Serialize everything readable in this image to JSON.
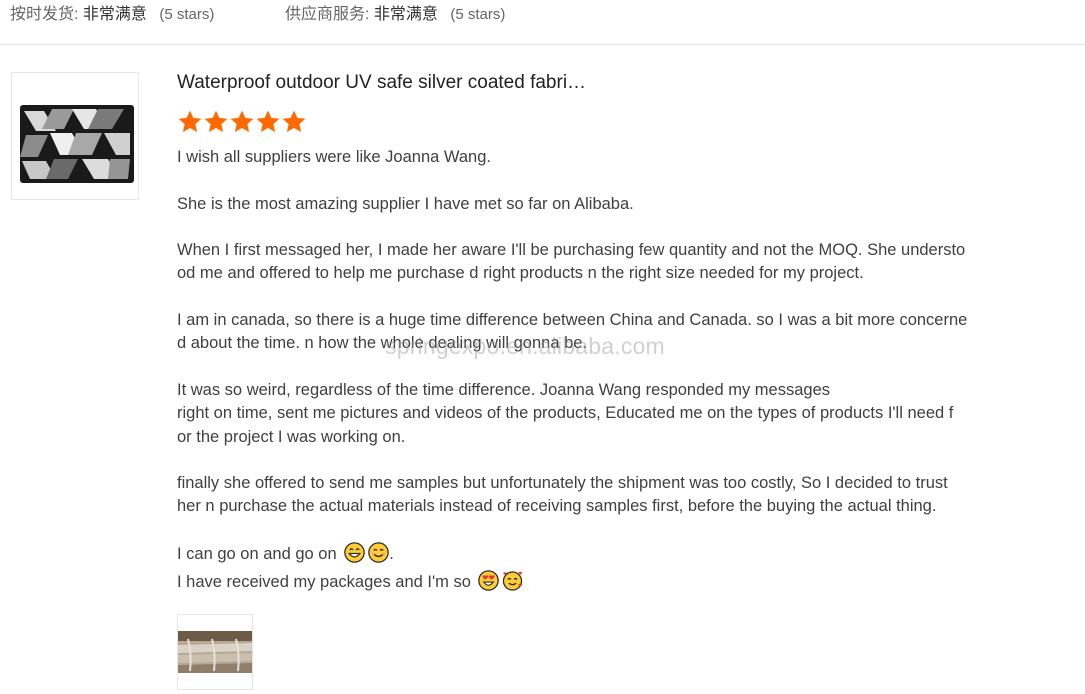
{
  "ratings": [
    {
      "label": "按时发货:",
      "value": "非常满意",
      "stars": "(5 stars)"
    },
    {
      "label": "供应商服务:",
      "value": "非常满意",
      "stars": "(5 stars)"
    }
  ],
  "product": {
    "title": "Waterproof outdoor UV safe silver coated fabri…",
    "rating": 5,
    "star_color": "#ff6a00"
  },
  "review": {
    "p1": "I wish all suppliers were like Joanna Wang.",
    "p2": "She is the most amazing supplier I have met so far on Alibaba.",
    "p3a": "When I  first messaged her, I made her aware I'll be purchasing few quantity and not the MOQ. She understo",
    "p3b": "od me and offered to help me purchase d right products n the right size needed for my project.",
    "p4a": "I am in canada, so there is a huge time difference between China and Canada. so I was a bit more concerne",
    "p4b": "d about the time. n how the whole dealing will gonna be.",
    "p5a": "It was so weird, regardless of the time difference. Joanna Wang responded my messages",
    "p5b": "right on time, sent me pictures and videos of the products, Educated me on the types of products I'll need f",
    "p5c": "or the project I was working on.",
    "p6a": "finally  she offered to send me samples but unfortunately the shipment was too costly, So I decided to trust",
    "p6b": "her n purchase the actual materials instead of receiving samples first, before the buying the actual thing.",
    "p7a": "I can go on and go on",
    "p7a_end": ".",
    "p7b": "I have received my packages and I'm so"
  },
  "watermark": "springexpo.en.alibaba.com"
}
